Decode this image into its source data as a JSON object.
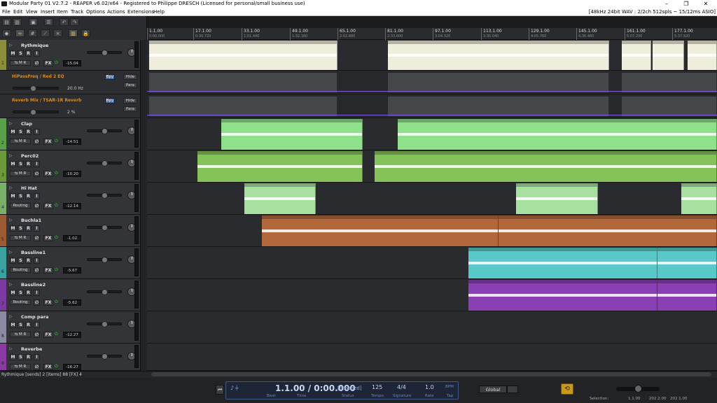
{
  "window": {
    "title": "Modular Party 01 V2.7.2 - REAPER v6.02/x64 - Registered to Philippe DRESCH (Licensed for personal/small business use)"
  },
  "menu": [
    "File",
    "Edit",
    "View",
    "Insert",
    "Item",
    "Track",
    "Options",
    "Actions",
    "Extensions",
    "Help"
  ],
  "audio_info": "[48kHz 24bit WAV : 2/2ch 512spls ~ 15/12ms ASIO]",
  "ruler": [
    {
      "bar": "1.1.00",
      "time": "0:00.000"
    },
    {
      "bar": "17.1.00",
      "time": "0:30.720"
    },
    {
      "bar": "33.1.00",
      "time": "1:01.440"
    },
    {
      "bar": "49.1.00",
      "time": "1:32.160"
    },
    {
      "bar": "65.1.00",
      "time": "2:02.880"
    },
    {
      "bar": "81.1.00",
      "time": "2:33.600"
    },
    {
      "bar": "97.1.00",
      "time": "3:04.320"
    },
    {
      "bar": "113.1.00",
      "time": "3:35.040"
    },
    {
      "bar": "129.1.00",
      "time": "4:05.760"
    },
    {
      "bar": "145.1.00",
      "time": "4:36.480"
    },
    {
      "bar": "161.1.00",
      "time": "5:07.200"
    },
    {
      "bar": "177.1.00",
      "time": "5:37.920"
    }
  ],
  "tracks": [
    {
      "num": "1",
      "name": "Rythmique",
      "vol": "-15.04",
      "color": "#8b8e3a",
      "io": "routing"
    },
    {
      "num": "",
      "name": "HiPassFreq / Red 2 EQ",
      "env": true,
      "value": "20.0 Hz",
      "chip1": "Bpy",
      "chip2": "Hide",
      "chip3": "Para"
    },
    {
      "num": "",
      "name": "Reverb Mix / TSAR-1R Reverb",
      "env": true,
      "value": "2 %",
      "chip1": "Bpy",
      "chip2": "Hide",
      "chip3": "Para"
    },
    {
      "num": "2",
      "name": "Clap",
      "vol": "-14.51",
      "color": "#5aa04a",
      "io": "routing"
    },
    {
      "num": "3",
      "name": "Perc02",
      "vol": "-10.20",
      "color": "#6b9a3a",
      "io": "routing"
    },
    {
      "num": "4",
      "name": "Hi Hat",
      "vol": "-12.14",
      "color": "#7bb06a",
      "io": "Routing"
    },
    {
      "num": "5",
      "name": "Buchla1",
      "vol": "-1.02",
      "color": "#9a5a34",
      "io": "routing"
    },
    {
      "num": "6",
      "name": "Bassline1",
      "vol": "-5.67",
      "color": "#3aa0a0",
      "io": "Routing"
    },
    {
      "num": "7",
      "name": "Bassline2",
      "vol": "-5.62",
      "color": "#7a3aa0",
      "io": "Routing"
    },
    {
      "num": "8",
      "name": "Comp para",
      "vol": "-12.27",
      "color": "#8a8aa0",
      "io": "routing"
    },
    {
      "num": "9",
      "name": "Reverbe",
      "vol": "-16.27",
      "color": "#8a3aa0",
      "io": "routing"
    }
  ],
  "buttons": {
    "mute": "M",
    "solo": "S",
    "rec": "R",
    "input": "I",
    "phase": "∅",
    "fx": "FX",
    "mr": "MR"
  },
  "status": "Rythmique [sends] 2 [items] 88 [FX] 4",
  "transport": {
    "position": "1.1.00 / 0:00.000",
    "state": "[Stopped]",
    "tempo": "125",
    "signature": "4/4",
    "rate": "1.0",
    "bpm_label": "BPM",
    "tap_label": "Tap",
    "labels": {
      "beat": "Beat",
      "time": "Time",
      "status": "Status",
      "tempo": "Tempo",
      "signature": "Signature",
      "rate": "Rate"
    },
    "global": "Global"
  },
  "selection": {
    "label": "Selection:",
    "start": "1.1.00",
    "end": "202.2.00",
    "length": "202.1.00"
  }
}
